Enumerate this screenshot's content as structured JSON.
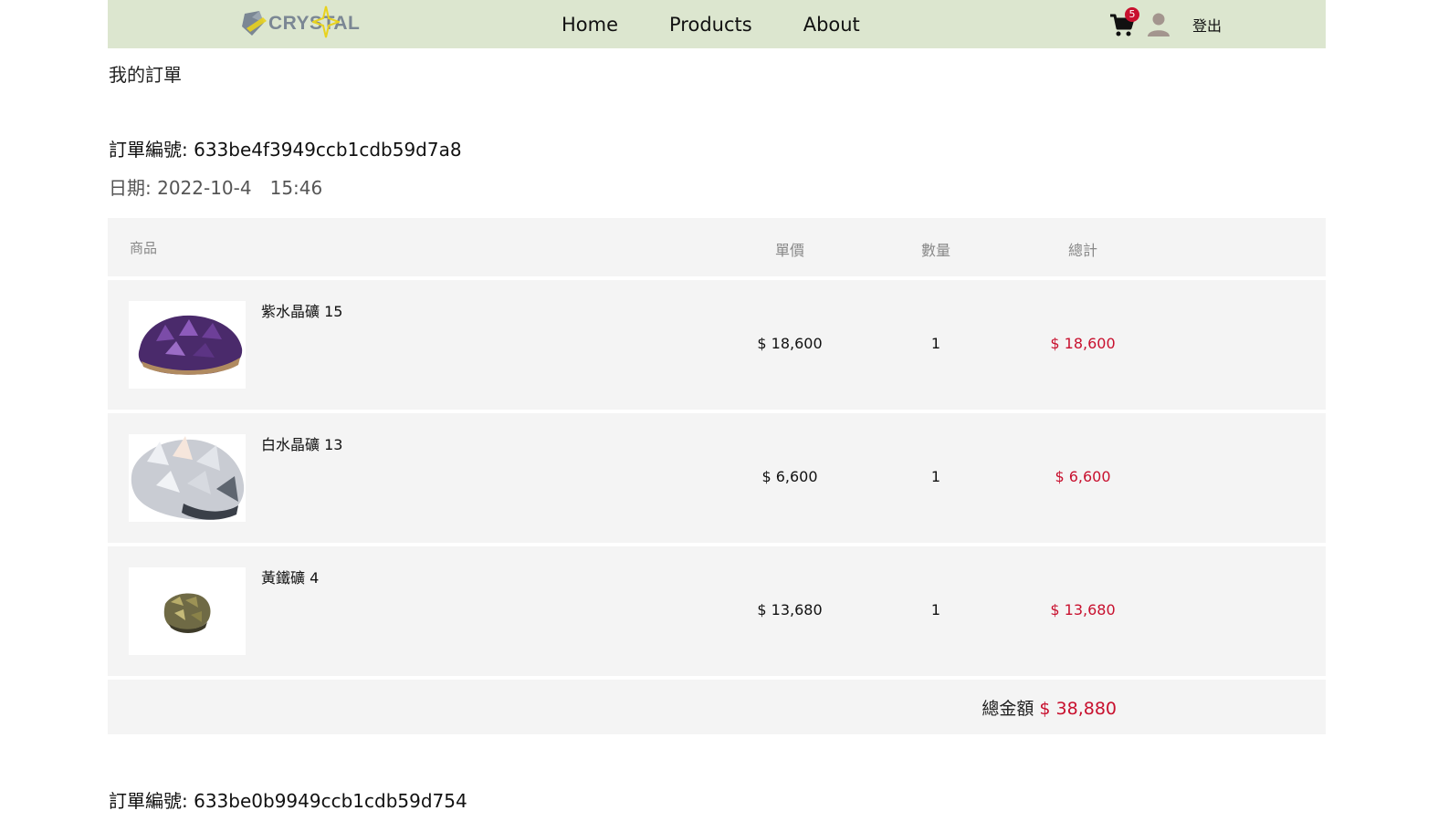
{
  "header": {
    "logo_text": "CRYSTAL",
    "nav": [
      {
        "label": "Home"
      },
      {
        "label": "Products"
      },
      {
        "label": "About"
      }
    ],
    "cart_count": "5",
    "logout_label": "登出"
  },
  "page": {
    "title": "我的訂單"
  },
  "orders": [
    {
      "number_label": "訂單編號: 633be4f3949ccb1cdb59d7a8",
      "date_label": "日期: 2022-10-4",
      "time": "15:46",
      "columns": {
        "product": "商品",
        "price": "單價",
        "qty": "數量",
        "total": "總計"
      },
      "items": [
        {
          "name": "紫水晶礦 15",
          "price": "$ 18,600",
          "qty": "1",
          "total": "$ 18,600",
          "image": "amethyst-cluster"
        },
        {
          "name": "白水晶礦 13",
          "price": "$ 6,600",
          "qty": "1",
          "total": "$ 6,600",
          "image": "clear-quartz-cluster"
        },
        {
          "name": "黃鐵礦 4",
          "price": "$ 13,680",
          "qty": "1",
          "total": "$ 13,680",
          "image": "pyrite-nugget"
        }
      ],
      "grand_total_label": "總金額",
      "grand_total": "$ 38,880"
    },
    {
      "number_label": "訂單編號: 633be0b9949ccb1cdb59d754"
    }
  ],
  "colors": {
    "navbar_bg": "#dce6cf",
    "accent_red": "#c8102e",
    "table_bg": "#f4f4f4"
  }
}
